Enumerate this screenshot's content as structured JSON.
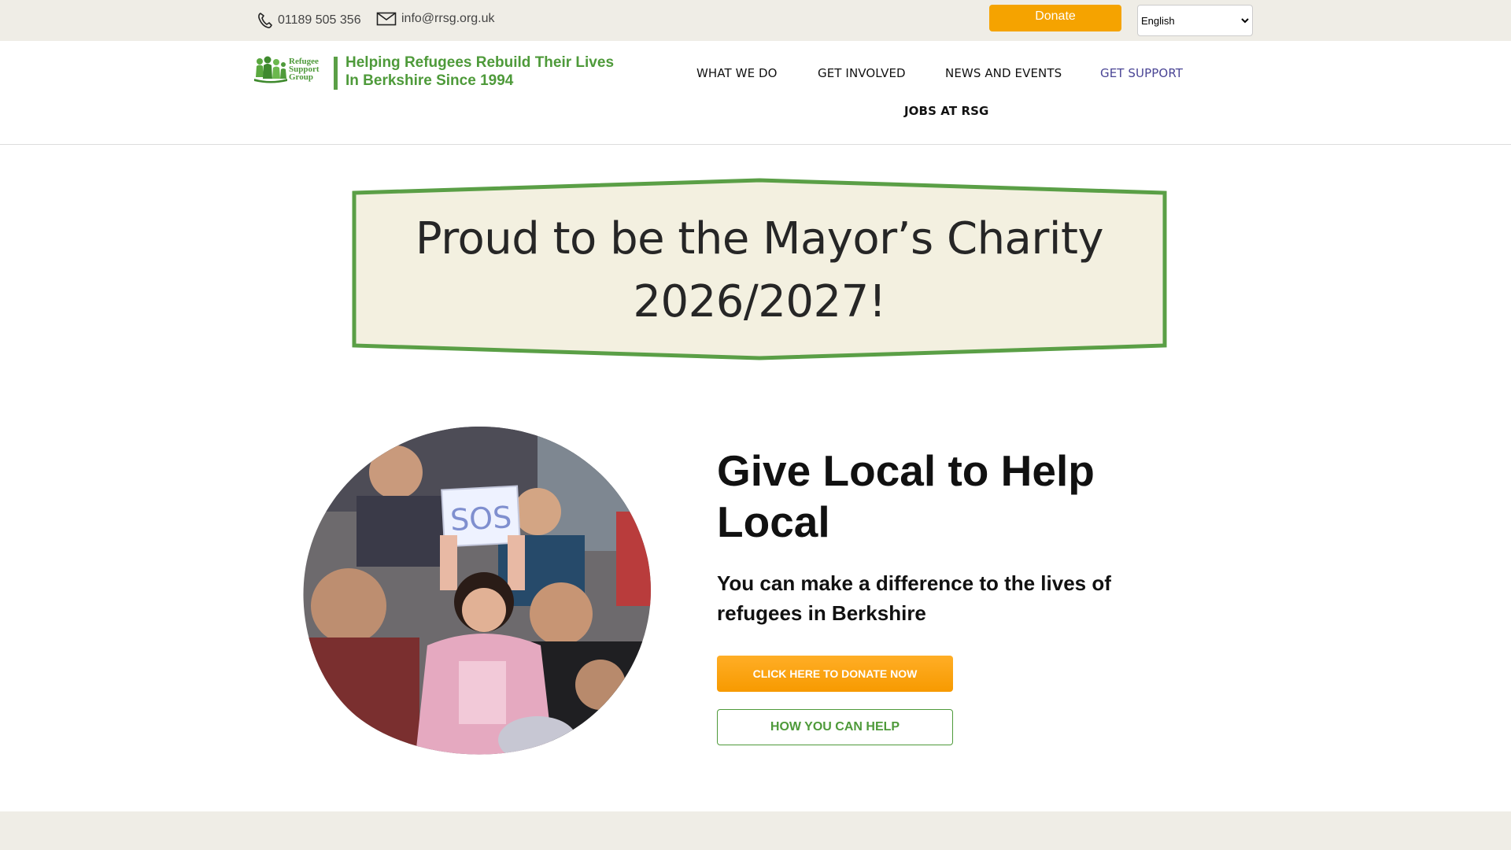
{
  "topbar": {
    "phone": "01189 505 356",
    "email": "info@rrsg.org.uk",
    "donate_label": "Donate",
    "language": "English"
  },
  "header": {
    "logo_text": [
      "Refugee",
      "Support",
      "Group"
    ],
    "tagline_line1": "Helping Refugees Rebuild Their Lives",
    "tagline_line2": "In Berkshire Since 1994",
    "nav": {
      "what_we_do": "WHAT WE DO",
      "get_involved": "GET INVOLVED",
      "news_events": "NEWS AND EVENTS",
      "get_support": "GET SUPPORT",
      "jobs": "JOBS AT RSG"
    }
  },
  "banner": {
    "line1": "Proud to be the Mayor’s Charity",
    "line2": "2026/2027!"
  },
  "hero": {
    "title": "Give Local to Help Local",
    "subtitle": "You can make a difference to the lives of refugees in Berkshire",
    "donate_button": "CLICK HERE TO DONATE NOW",
    "help_button": "HOW YOU CAN HELP",
    "sign_text": "SOS"
  },
  "colors": {
    "accent_green": "#4e9a3a",
    "accent_orange": "#f5a300",
    "nav_highlight": "#4a4595",
    "banner_fill": "#f3f0e0",
    "topbar_bg": "#efede6"
  }
}
